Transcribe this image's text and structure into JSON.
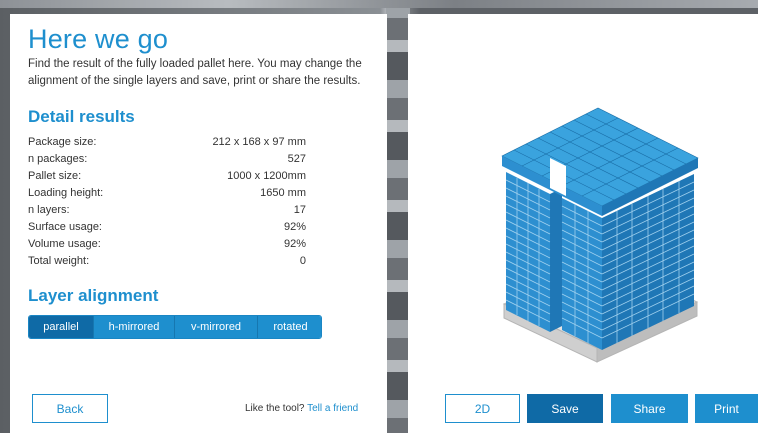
{
  "header": {
    "title": "Here we go",
    "intro": "Find the result of the fully loaded pallet here. You may change the alignment of the single layers and save, print or share the results."
  },
  "detail": {
    "title": "Detail results",
    "rows": [
      {
        "label": "Package size:",
        "value": "212 x 168 x 97 mm"
      },
      {
        "label": "n packages:",
        "value": "527"
      },
      {
        "label": "Pallet size:",
        "value": "1000 x 1200mm"
      },
      {
        "label": "Loading height:",
        "value": "1650 mm"
      },
      {
        "label": "n layers:",
        "value": "17"
      },
      {
        "label": "Surface usage:",
        "value": "92%"
      },
      {
        "label": "Volume usage:",
        "value": "92%"
      },
      {
        "label": "Total weight:",
        "value": "0"
      }
    ]
  },
  "layer_alignment": {
    "title": "Layer alignment",
    "options": [
      "parallel",
      "h-mirrored",
      "v-mirrored",
      "rotated"
    ],
    "selected": "parallel"
  },
  "footer": {
    "back_label": "Back",
    "friend_text": "Like the tool?",
    "friend_link": "Tell a friend"
  },
  "actions": {
    "view_2d": "2D",
    "save": "Save",
    "share": "Share",
    "print": "Print"
  },
  "colors": {
    "accent": "#1e8fce",
    "accent_dark": "#0f6aa6",
    "box_top": "#3aa3de",
    "box_side": "#1b7fc0"
  },
  "icons": {
    "pallet": "pallet-3d-illustration"
  }
}
